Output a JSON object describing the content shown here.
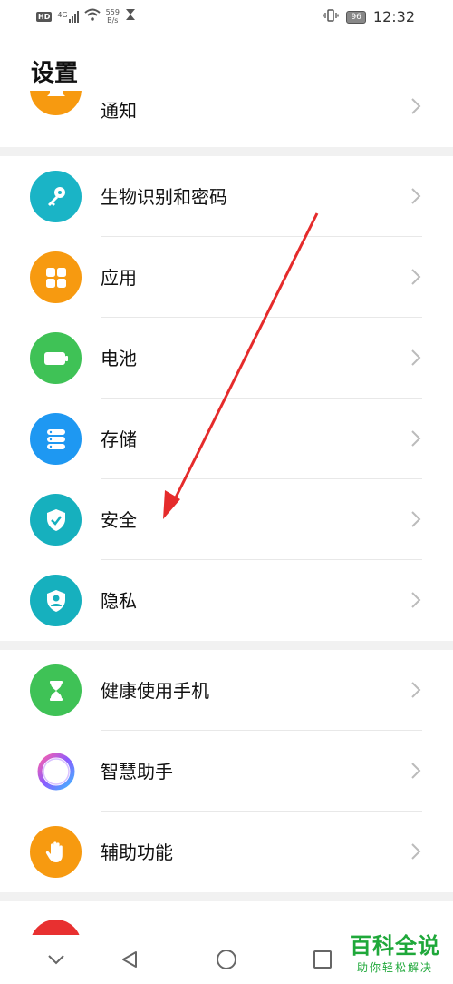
{
  "status_bar": {
    "hd": "HD",
    "network_type": "4G",
    "net_speed_value": "559",
    "net_speed_unit": "B/s",
    "battery": "96",
    "time": "12:32"
  },
  "page": {
    "title": "设置"
  },
  "partial_top": {
    "label": "通知"
  },
  "groups": [
    {
      "items": [
        {
          "label": "生物识别和密码",
          "icon": "key-icon",
          "color": "#1ab4c6"
        },
        {
          "label": "应用",
          "icon": "apps-grid-icon",
          "color": "#f79a10"
        },
        {
          "label": "电池",
          "icon": "battery-icon",
          "color": "#3fc256"
        },
        {
          "label": "存储",
          "icon": "storage-icon",
          "color": "#1e98f2"
        },
        {
          "label": "安全",
          "icon": "shield-check-icon",
          "color": "#16b0be"
        },
        {
          "label": "隐私",
          "icon": "privacy-shield-icon",
          "color": "#16b0be"
        }
      ]
    },
    {
      "items": [
        {
          "label": "健康使用手机",
          "icon": "hourglass-icon",
          "color": "#3fc256"
        },
        {
          "label": "智慧助手",
          "icon": "smart-assistant-icon",
          "color": "#ffffff"
        },
        {
          "label": "辅助功能",
          "icon": "hand-icon",
          "color": "#f79a10"
        }
      ]
    }
  ],
  "bottom_partial_color": "#e83030",
  "accent_arrow_color": "#e52b2b",
  "watermark": {
    "main": "百科全说",
    "sub": "助你轻松解决"
  }
}
